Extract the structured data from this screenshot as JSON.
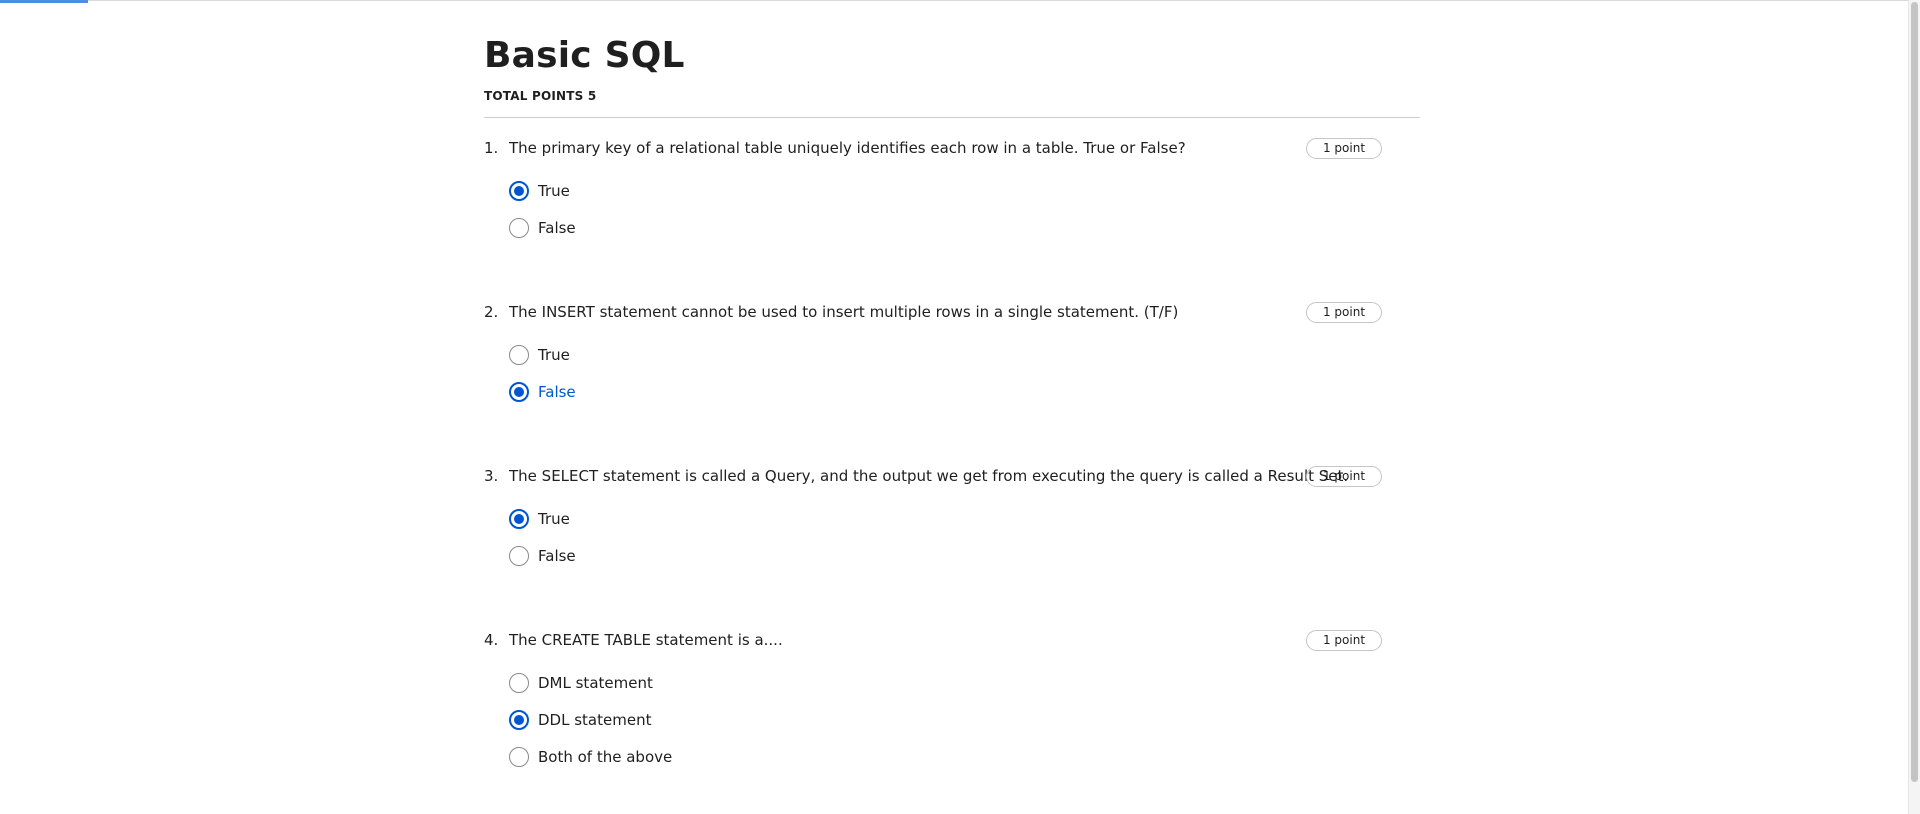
{
  "quiz": {
    "title": "Basic SQL",
    "total_points": "TOTAL POINTS 5",
    "accent_color": "#0056d2",
    "questions": [
      {
        "number": "1.",
        "text": "The primary key of a relational table uniquely identifies each row in a table. True or False?",
        "points": "1 point",
        "options": [
          {
            "label": "True",
            "selected": true
          },
          {
            "label": "False",
            "selected": false
          }
        ]
      },
      {
        "number": "2.",
        "text": "The INSERT statement cannot be used to insert multiple rows in a single statement. (T/F)",
        "points": "1 point",
        "options": [
          {
            "label": "True",
            "selected": false
          },
          {
            "label": "False",
            "selected": true
          }
        ]
      },
      {
        "number": "3.",
        "text": "The SELECT statement is called a Query, and the output we get from executing the query is called a Result Set.",
        "points": "1 point",
        "options": [
          {
            "label": "True",
            "selected": true
          },
          {
            "label": "False",
            "selected": false
          }
        ]
      },
      {
        "number": "4.",
        "text": "The CREATE TABLE statement is a....",
        "points": "1 point",
        "options": [
          {
            "label": "DML statement",
            "selected": false
          },
          {
            "label": "DDL statement",
            "selected": true
          },
          {
            "label": "Both of the above",
            "selected": false
          }
        ]
      }
    ]
  }
}
